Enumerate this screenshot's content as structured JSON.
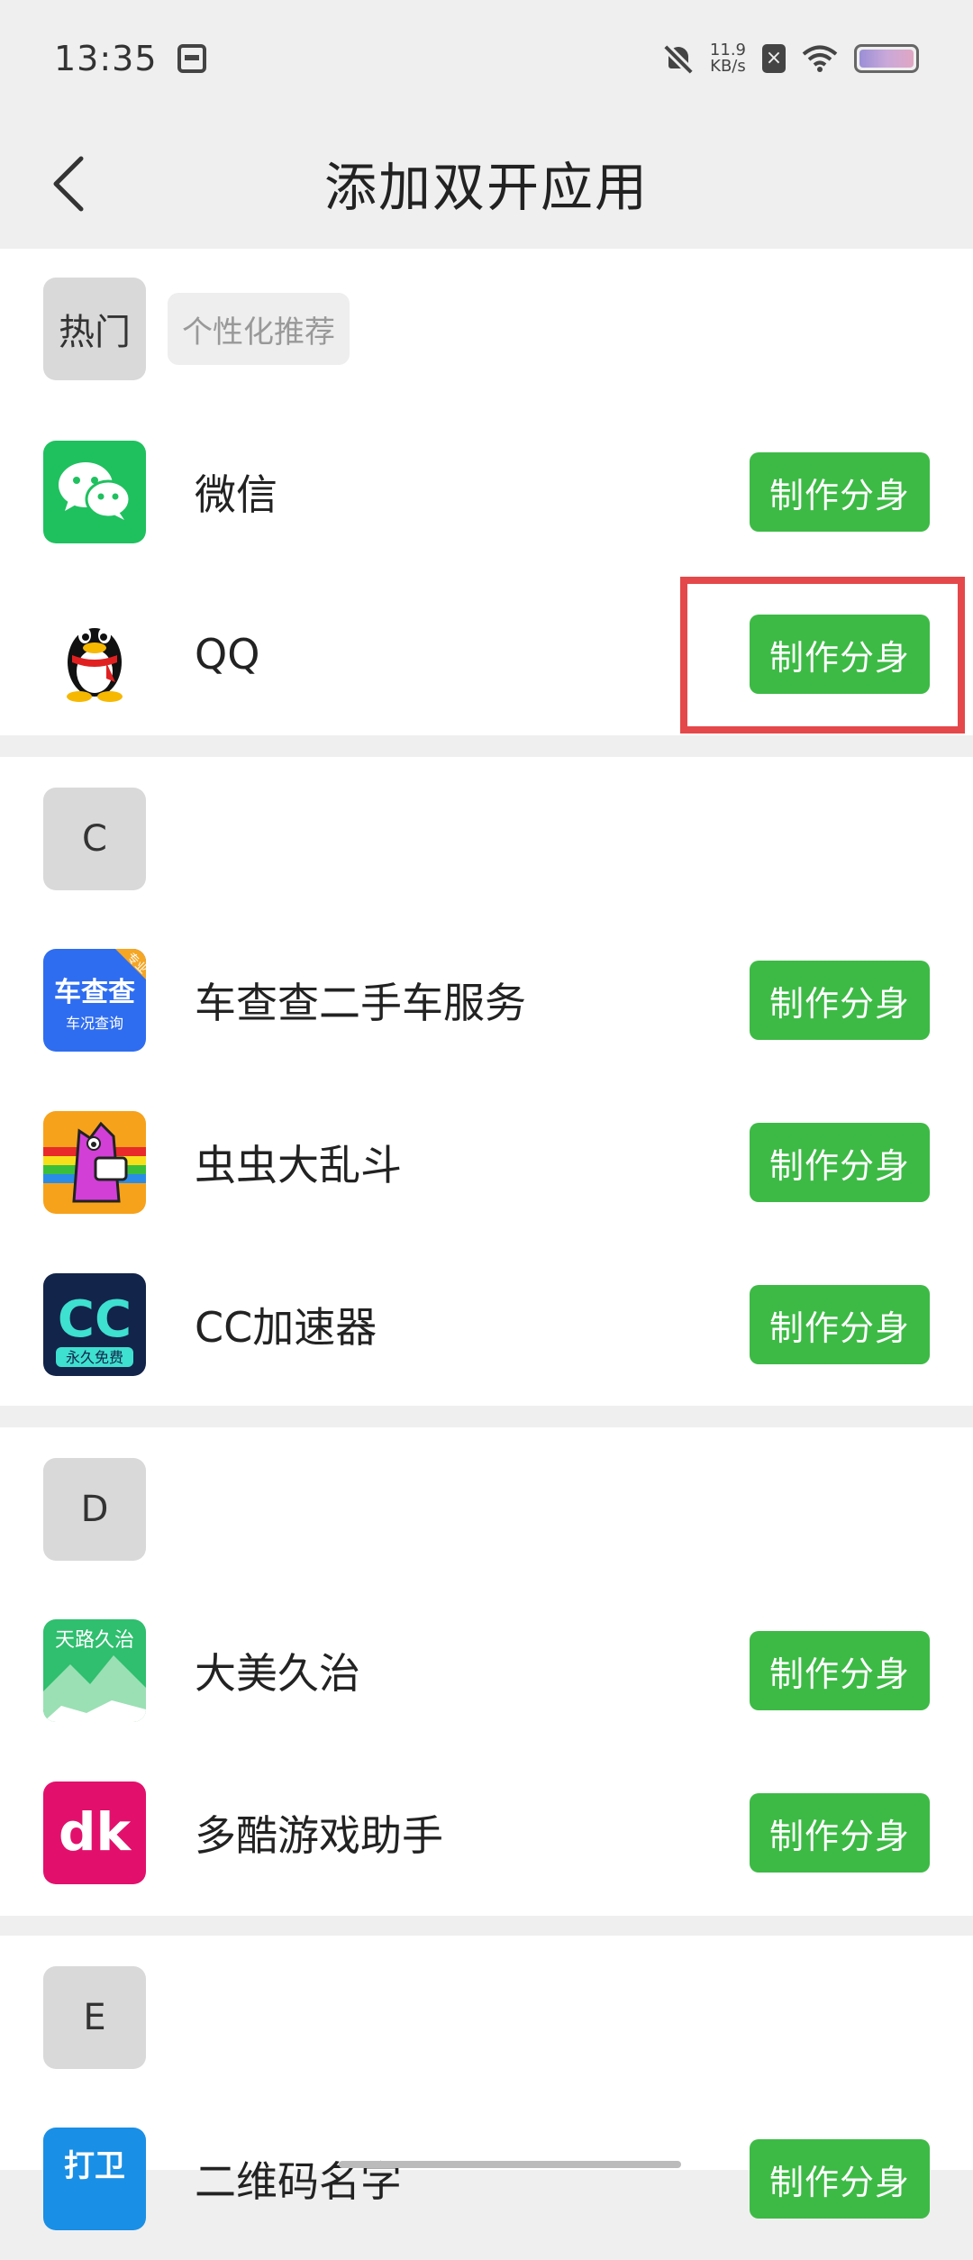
{
  "status_bar": {
    "time": "13:35",
    "net_speed_value": "11.9",
    "net_speed_unit": "KB/s",
    "x_badge": "×"
  },
  "header": {
    "title": "添加双开应用"
  },
  "sections": [
    {
      "badge": "热门",
      "tag": "个性化推荐",
      "apps": [
        {
          "name": "微信",
          "button": "制作分身",
          "icon": "wechat-icon"
        },
        {
          "name": "QQ",
          "button": "制作分身",
          "icon": "qq-icon"
        }
      ]
    },
    {
      "badge": "C",
      "apps": [
        {
          "name": "车查查二手车服务",
          "button": "制作分身",
          "icon": "chechacha-icon",
          "icon_text_top": "车查查",
          "icon_text_bottom": "车况查询",
          "icon_ribbon": "专业"
        },
        {
          "name": "虫虫大乱斗",
          "button": "制作分身",
          "icon": "chongchong-icon"
        },
        {
          "name": "CC加速器",
          "button": "制作分身",
          "icon": "cc-accelerator-icon",
          "icon_text": "CC",
          "icon_subtext": "永久免费"
        }
      ]
    },
    {
      "badge": "D",
      "apps": [
        {
          "name": "大美久治",
          "button": "制作分身",
          "icon": "dameijiuzhi-icon",
          "icon_text": "天路久治"
        },
        {
          "name": "多酷游戏助手",
          "button": "制作分身",
          "icon": "duoku-icon",
          "icon_text": "dk"
        }
      ]
    },
    {
      "badge": "E",
      "apps": [
        {
          "name": "二维码名字",
          "button": "制作分身",
          "icon": "erweima-icon",
          "icon_text": "打卫"
        }
      ]
    }
  ],
  "colors": {
    "button_green": "#3dba45",
    "highlight_red": "#e5484a",
    "wechat_green": "#1fc15f",
    "chechacha_blue": "#2f6df0",
    "duoku_pink": "#e2106c"
  }
}
